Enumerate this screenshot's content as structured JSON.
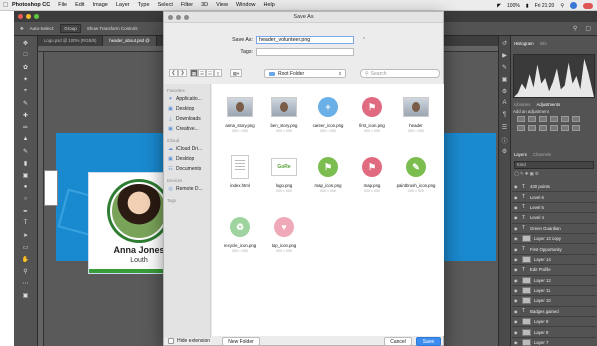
{
  "menubar": {
    "app": "Photoshop CC",
    "menus": [
      "File",
      "Edit",
      "Image",
      "Layer",
      "Type",
      "Select",
      "Filter",
      "3D",
      "View",
      "Window",
      "Help"
    ],
    "battery": "100%",
    "clock": "Fri 21:20"
  },
  "photoshop": {
    "options": {
      "auto_select": "Auto-Select:",
      "group": "Group",
      "transform": "Show Transform Controls"
    },
    "tabs": [
      "Logo.psd @ 100% (RGB/8)",
      "header_about.psd @"
    ],
    "card": {
      "name": "Anna Jones",
      "place": "Louth"
    },
    "panels": {
      "histogram_tabs": [
        "Histogram",
        "Info"
      ],
      "adj_tabs": [
        "Libraries",
        "Adjustments"
      ],
      "adj_title": "Add an adjustment",
      "layers_tabs": [
        "Layers",
        "Channels"
      ],
      "kind": "Kind",
      "layers": [
        "430 points",
        "Level 6",
        "Level 5",
        "Level 4",
        "Green Guardian",
        "Layer 13 copy",
        "First Opportunity",
        "Layer 14",
        "Edit Profile",
        "Layer 12",
        "Layer 11",
        "Layer 10",
        "Badges gained",
        "Layer 9",
        "Layer 8",
        "Layer 7",
        "Layer 6"
      ]
    }
  },
  "dialog": {
    "title": "Save As",
    "save_as_label": "Save As:",
    "save_as_value": "header_volunteer.png",
    "tags_label": "Tags:",
    "tags_value": "",
    "folder": "Root Folder",
    "search_placeholder": "Search",
    "sidebar": {
      "favorites": "Favorites",
      "fav_items": [
        "Applicatio...",
        "Desktop",
        "Downloads",
        "Creative..."
      ],
      "icloud": "iCloud",
      "icloud_items": [
        "iCloud Dri...",
        "Desktop",
        "Documents"
      ],
      "devices": "Devices",
      "device_items": [
        "Remote D..."
      ],
      "tags": "Tags"
    },
    "files": [
      {
        "name": "anna_story.png",
        "size": "000 × 000",
        "kind": "photo"
      },
      {
        "name": "ben_story.png",
        "size": "000 × 000",
        "kind": "photo"
      },
      {
        "name": "career_icon.png",
        "size": "000 × 000",
        "kind": "plus",
        "color": "#6ab0e6"
      },
      {
        "name": "first_icon.png",
        "size": "000 × 000",
        "kind": "pin",
        "color": "#e06a80"
      },
      {
        "name": "header",
        "size": "000 × 000",
        "kind": "photo"
      },
      {
        "name": "index.html",
        "size": "",
        "kind": "doc"
      },
      {
        "name": "logo.png",
        "size": "000 × 000",
        "kind": "logo"
      },
      {
        "name": "map_icon.png",
        "size": "000 × 000",
        "kind": "pin",
        "color": "#7bbd4f"
      },
      {
        "name": "map.png",
        "size": "000 × 000",
        "kind": "pin",
        "color": "#e06a80"
      },
      {
        "name": "paintbrush_icon.png",
        "size": "000 × 000",
        "kind": "brush",
        "color": "#7bbd4f"
      },
      {
        "name": "recycle_icon.png",
        "size": "000 × 000",
        "kind": "recycle",
        "color": "#9fd4a0"
      },
      {
        "name": "top_icon.png",
        "size": "000 × 000",
        "kind": "top",
        "color": "#f0a9b8"
      }
    ],
    "hide_extension": "Hide extension",
    "new_folder": "New Folder",
    "cancel": "Cancel",
    "save": "Save"
  },
  "colors": {
    "accent": "#3b8eef",
    "banner": "#1a8ad0",
    "card_green": "#3a9b3a"
  }
}
